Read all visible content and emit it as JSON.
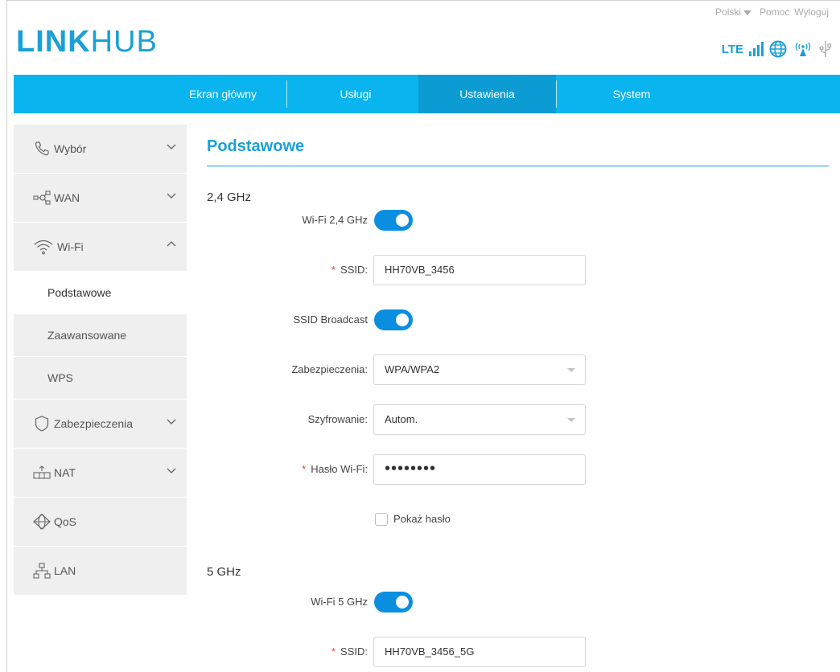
{
  "brand": {
    "logo_bold": "LINK",
    "logo_light": "HUB"
  },
  "toplinks": {
    "language": "Polski",
    "help": "Pomoc",
    "logout": "Wyloguj"
  },
  "status": {
    "network": "LTE",
    "icons": [
      "signal-bars-icon",
      "globe-icon",
      "wifi-broadcast-icon",
      "usb-icon"
    ]
  },
  "nav": {
    "items": [
      "Ekran główny",
      "Usługi",
      "Ustawienia",
      "System"
    ],
    "active": "Ustawienia"
  },
  "sidebar": {
    "items": [
      {
        "label": "Wybór",
        "icon": "phone-icon"
      },
      {
        "label": "WAN",
        "icon": "network-icon"
      },
      {
        "label": "Wi-Fi",
        "icon": "wifi-icon",
        "expanded": true
      },
      {
        "label": "Zabezpieczenia",
        "icon": "shield-icon"
      },
      {
        "label": "NAT",
        "icon": "nat-icon"
      },
      {
        "label": "QoS",
        "icon": "qos-icon"
      },
      {
        "label": "LAN",
        "icon": "lan-icon"
      }
    ],
    "wifi_sub": [
      "Podstawowe",
      "Zaawansowane",
      "WPS"
    ],
    "active_sub": "Podstawowe"
  },
  "main": {
    "title": "Podstawowe",
    "band24": {
      "heading": "2,4 GHz",
      "wifi_label": "Wi-Fi 2,4 GHz",
      "wifi_on": true,
      "ssid_label": "SSID:",
      "ssid_value": "HH70VB_3456",
      "broadcast_label": "SSID Broadcast",
      "broadcast_on": true,
      "security_label": "Zabezpieczenia:",
      "security_value": "WPA/WPA2",
      "encryption_label": "Szyfrowanie:",
      "encryption_value": "Autom.",
      "password_label": "Hasło Wi-Fi:",
      "password_value": "••••••••",
      "show_password_label": "Pokaż hasło"
    },
    "band5": {
      "heading": "5 GHz",
      "wifi_label": "Wi-Fi 5 GHz",
      "wifi_on": true,
      "ssid_label": "SSID:",
      "ssid_value": "HH70VB_3456_5G"
    }
  },
  "colors": {
    "accent": "#1aa0d8",
    "navbar": "#0ab4ee",
    "navbar_active": "#0c9bd2",
    "toggle": "#0a8fe0",
    "required": "#e24a3b"
  }
}
